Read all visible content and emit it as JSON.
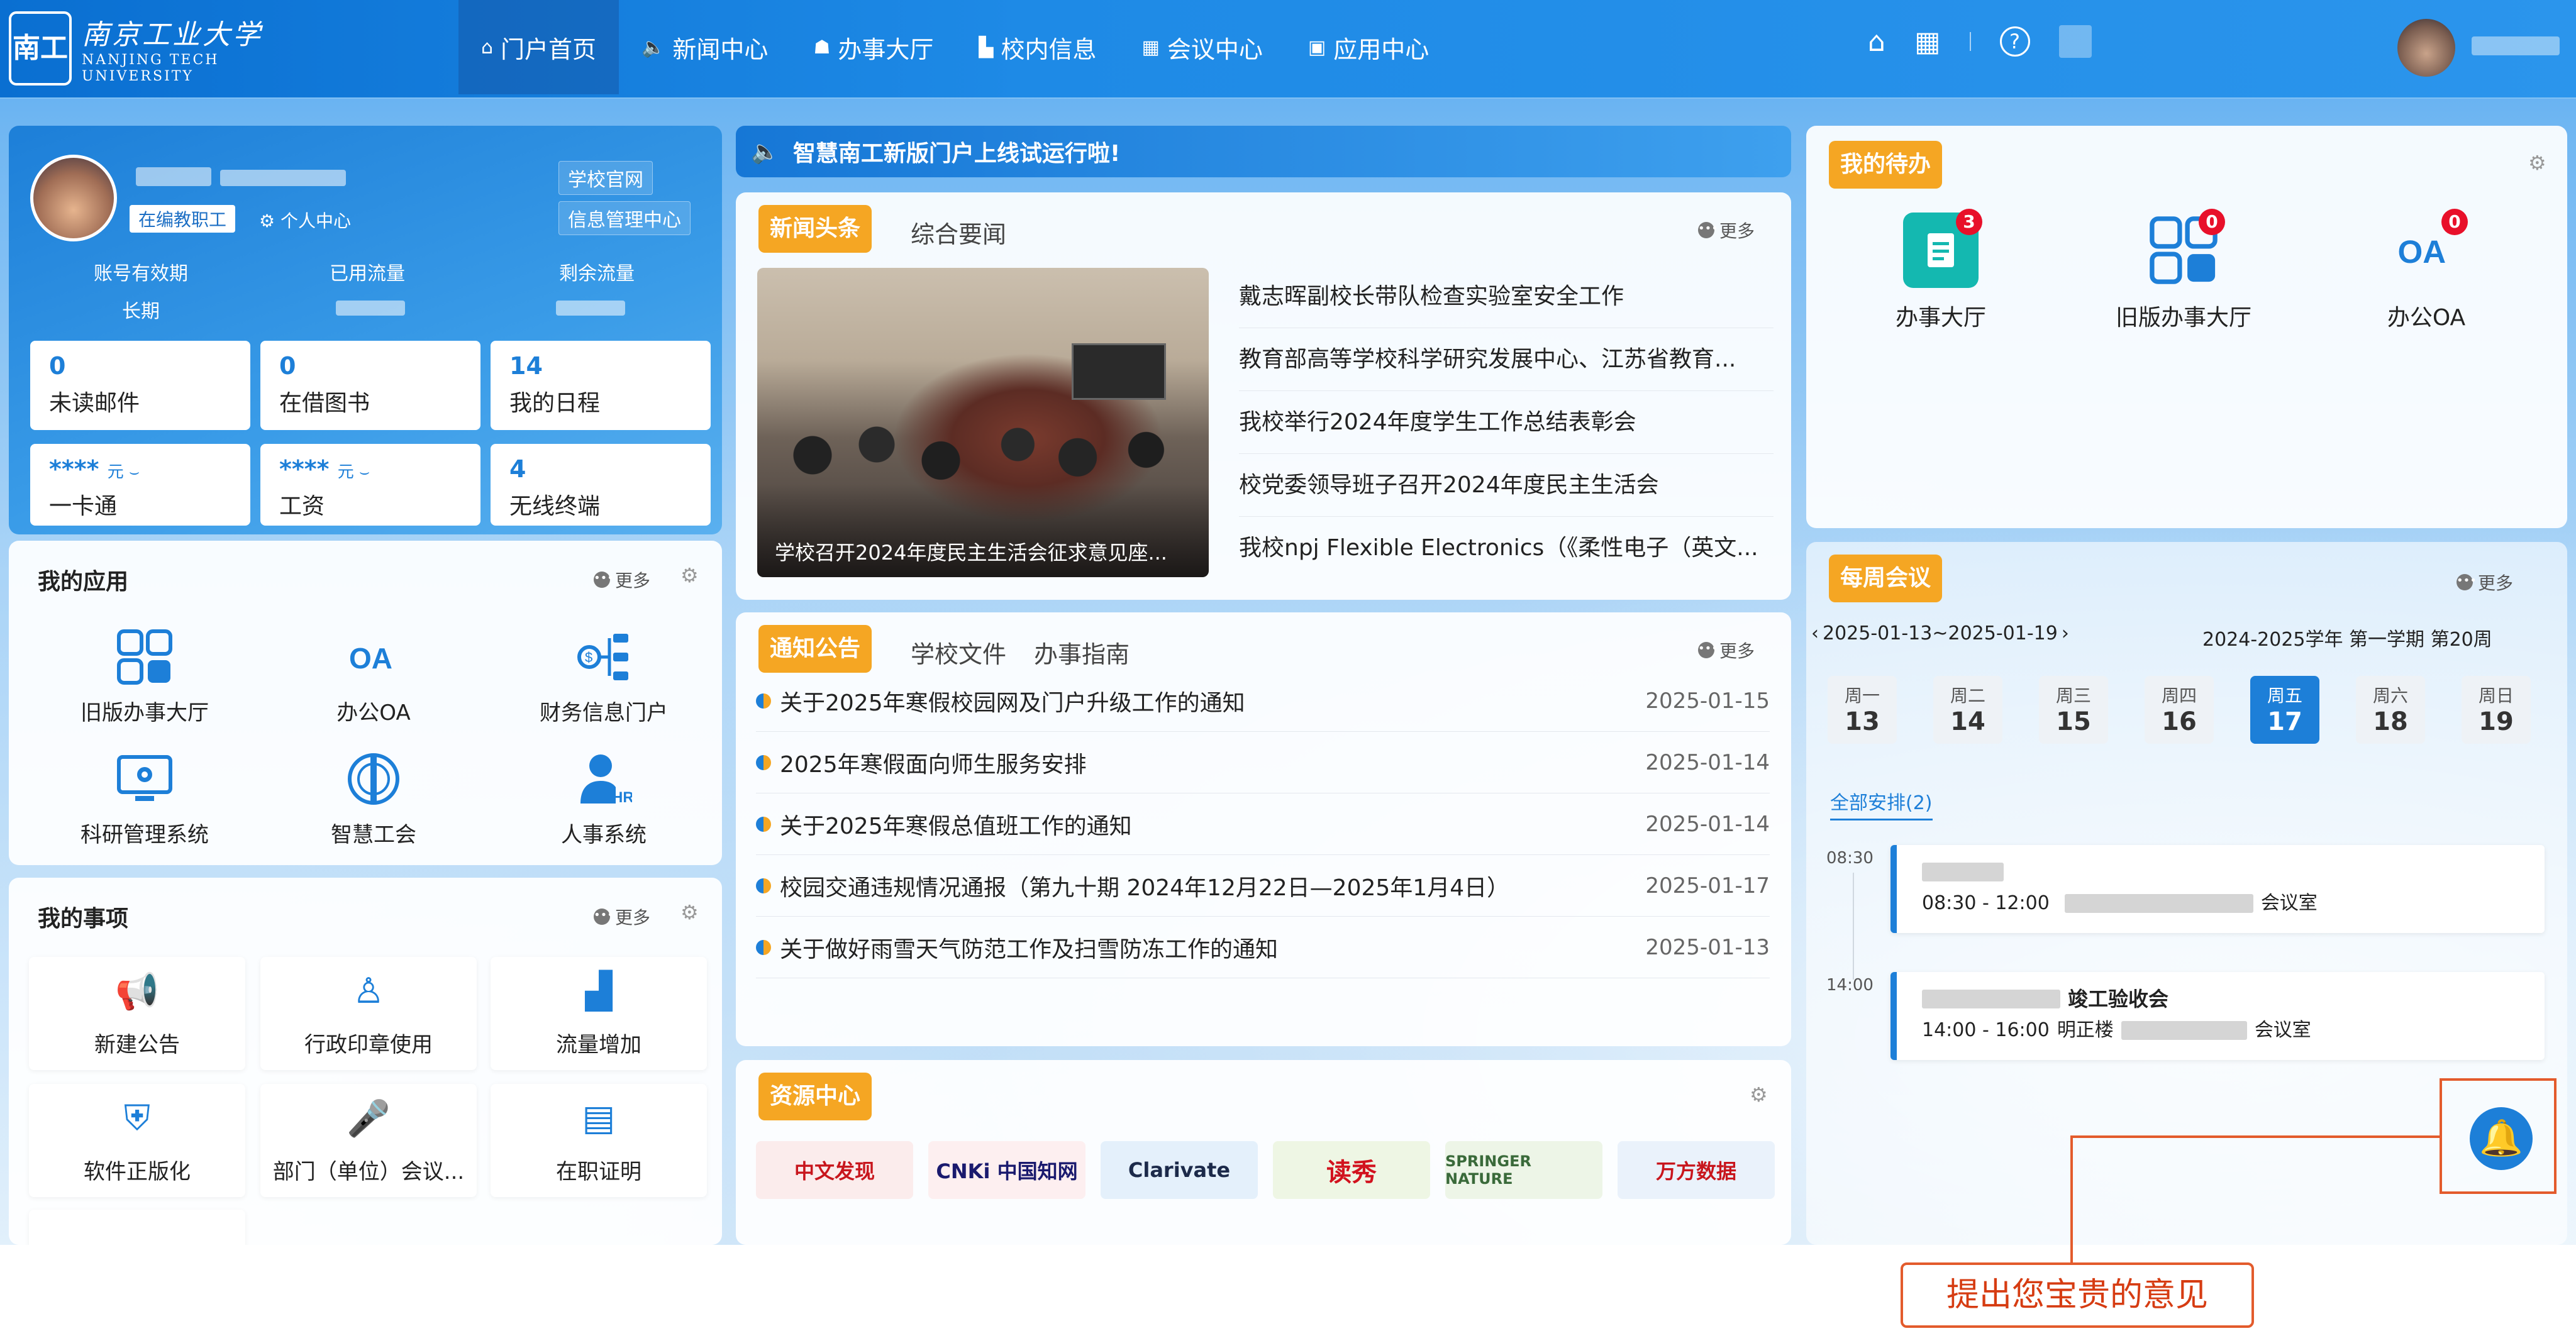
{
  "header": {
    "logo_badge": "南工",
    "logo_cn": "南京工业大学",
    "logo_en_1": "NANJING TECH",
    "logo_en_2": "UNIVERSITY",
    "nav": [
      {
        "icon": "⌂",
        "label": "门户首页"
      },
      {
        "icon": "🔈",
        "label": "新闻中心"
      },
      {
        "icon": "☗",
        "label": "办事大厅"
      },
      {
        "icon": "▙",
        "label": "校内信息"
      },
      {
        "icon": "▦",
        "label": "会议中心"
      },
      {
        "icon": "▣",
        "label": "应用中心"
      }
    ],
    "right_icons": {
      "home": "⌂",
      "grid": "▦",
      "help": "?"
    }
  },
  "profile": {
    "status_badge": "在编教职工",
    "personal_center": "⚙ 个人中心",
    "link_school": "学校官网",
    "link_info": "信息管理中心",
    "stats": [
      {
        "label": "账号有效期",
        "value": "长期"
      },
      {
        "label": "已用流量",
        "value": ""
      },
      {
        "label": "剩余流量",
        "value": ""
      }
    ],
    "tiles": [
      {
        "num": "0",
        "label": "未读邮件"
      },
      {
        "num": "0",
        "label": "在借图书"
      },
      {
        "num": "14",
        "label": "我的日程"
      },
      {
        "num": "****",
        "unit": "元 ⌣",
        "label": "一卡通"
      },
      {
        "num": "****",
        "unit": "元 ⌣",
        "label": "工资"
      },
      {
        "num": "4",
        "label": "无线终端"
      }
    ]
  },
  "my_apps": {
    "title": "我的应用",
    "more": "更多",
    "items": [
      "旧版办事大厅",
      "办公OA",
      "财务信息门户",
      "科研管理系统",
      "智慧工会",
      "人事系统"
    ]
  },
  "my_matters": {
    "title": "我的事项",
    "more": "更多",
    "items": [
      "新建公告",
      "行政印章使用",
      "流量增加",
      "软件正版化",
      "部门（单位）会议...",
      "在职证明"
    ]
  },
  "banner": {
    "text": "智慧南工新版门户上线试运行啦!"
  },
  "news": {
    "tab_active": "新闻头条",
    "tab_other": "综合要闻",
    "more": "更多",
    "image_caption": "学校召开2024年度民主生活会征求意见座...",
    "items": [
      "戴志晖副校长带队检查实验室安全工作",
      "教育部高等学校科学研究发展中心、江苏省教育...",
      "我校举行2024年度学生工作总结表彰会",
      "校党委领导班子召开2024年度民主生活会",
      "我校npj Flexible Electronics（《柔性电子（英文..."
    ]
  },
  "notices": {
    "tab_active": "通知公告",
    "tab_2": "学校文件",
    "tab_3": "办事指南",
    "more": "更多",
    "rows": [
      {
        "title": "关于2025年寒假校园网及门户升级工作的通知",
        "date": "2025-01-15"
      },
      {
        "title": "2025年寒假面向师生服务安排",
        "date": "2025-01-14"
      },
      {
        "title": "关于2025年寒假总值班工作的通知",
        "date": "2025-01-14"
      },
      {
        "title": "校园交通违规情况通报（第九十期 2024年12月22日—2025年1月4日）",
        "date": "2025-01-17"
      },
      {
        "title": "关于做好雨雪天气防范工作及扫雪防冻工作的通知",
        "date": "2025-01-13"
      }
    ]
  },
  "resources": {
    "title": "资源中心",
    "items": [
      "中文发现",
      "CNKi 中国知网",
      "Clarivate",
      "读秀",
      "SPRINGER NATURE",
      "万方数据"
    ]
  },
  "todo": {
    "title": "我的待办",
    "items": [
      {
        "label": "办事大厅",
        "count": "3"
      },
      {
        "label": "旧版办事大厅",
        "count": "0"
      },
      {
        "label": "办公OA",
        "count": "0"
      }
    ]
  },
  "meeting": {
    "title": "每周会议",
    "more": "更多",
    "range": "2025-01-13~2025-01-19",
    "term": "2024-2025学年 第一学期 第20周",
    "days": [
      {
        "w": "周一",
        "n": "13"
      },
      {
        "w": "周二",
        "n": "14"
      },
      {
        "w": "周三",
        "n": "15"
      },
      {
        "w": "周四",
        "n": "16"
      },
      {
        "w": "周五",
        "n": "17",
        "active": true
      },
      {
        "w": "周六",
        "n": "18"
      },
      {
        "w": "周日",
        "n": "19"
      }
    ],
    "all_label": "全部安排(2)",
    "events": [
      {
        "start": "08:30",
        "line1": "",
        "time": "08:30 - 12:00",
        "place_prefix": "",
        "place": "会议室"
      },
      {
        "start": "14:00",
        "line1": "竣工验收会",
        "time": "14:00 - 16:00",
        "place_prefix": "明正楼",
        "place": "会议室"
      }
    ]
  },
  "feedback": {
    "text": "提出您宝贵的意见"
  },
  "colors": {
    "primary": "#1d7fd8",
    "accent": "#f5a623",
    "badge": "#e8102a",
    "callout": "#e35b2c"
  }
}
